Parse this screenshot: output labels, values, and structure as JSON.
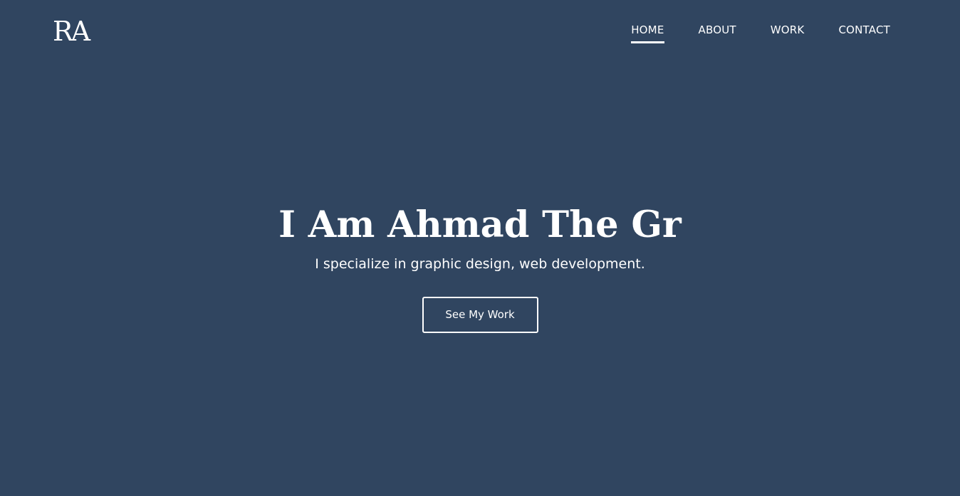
{
  "header": {
    "logo_text": "RA",
    "nav": [
      {
        "label": "HOME",
        "active": true
      },
      {
        "label": "ABOUT",
        "active": false
      },
      {
        "label": "WORK",
        "active": false
      },
      {
        "label": "CONTACT",
        "active": false
      }
    ]
  },
  "hero": {
    "title": "I Am Ahmad The Gr",
    "subtitle": "I specialize in graphic design, web development.",
    "cta_label": "See My Work"
  },
  "colors": {
    "background": "#304560",
    "text": "#ffffff"
  }
}
